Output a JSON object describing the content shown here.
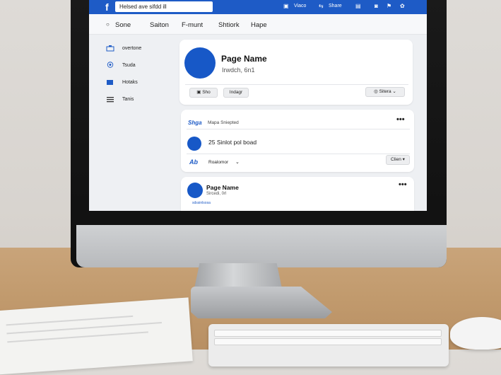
{
  "topbar": {
    "search_value": "Helsed ave sifdd ill",
    "items": [
      "Viaco",
      "Share"
    ]
  },
  "nav": [
    "Sone",
    "Saiton",
    "F-munt",
    "Shtiork",
    "Hape"
  ],
  "sidebar": [
    "overtone",
    "Tsuda",
    "Hotaks",
    "Tanis"
  ],
  "profile": {
    "name": "Page Name",
    "subtitle": "Irwdch, 6n1",
    "btn_left": "Sho",
    "btn_mid": "Indagr",
    "btn_right": "Sitera"
  },
  "post1": {
    "header_label": "Shga",
    "header_text": "Mapa Sniepted",
    "body": "25 Sinlot pol boad",
    "footer_label": "Roalomor",
    "footer_btn": "Clien"
  },
  "post2": {
    "name": "Page Name",
    "subtitle": "Sircedi, 0rl",
    "link": "sdssinlsosa"
  },
  "colors": {
    "brand": "#1e5bc6",
    "avatar": "#1758c7"
  }
}
